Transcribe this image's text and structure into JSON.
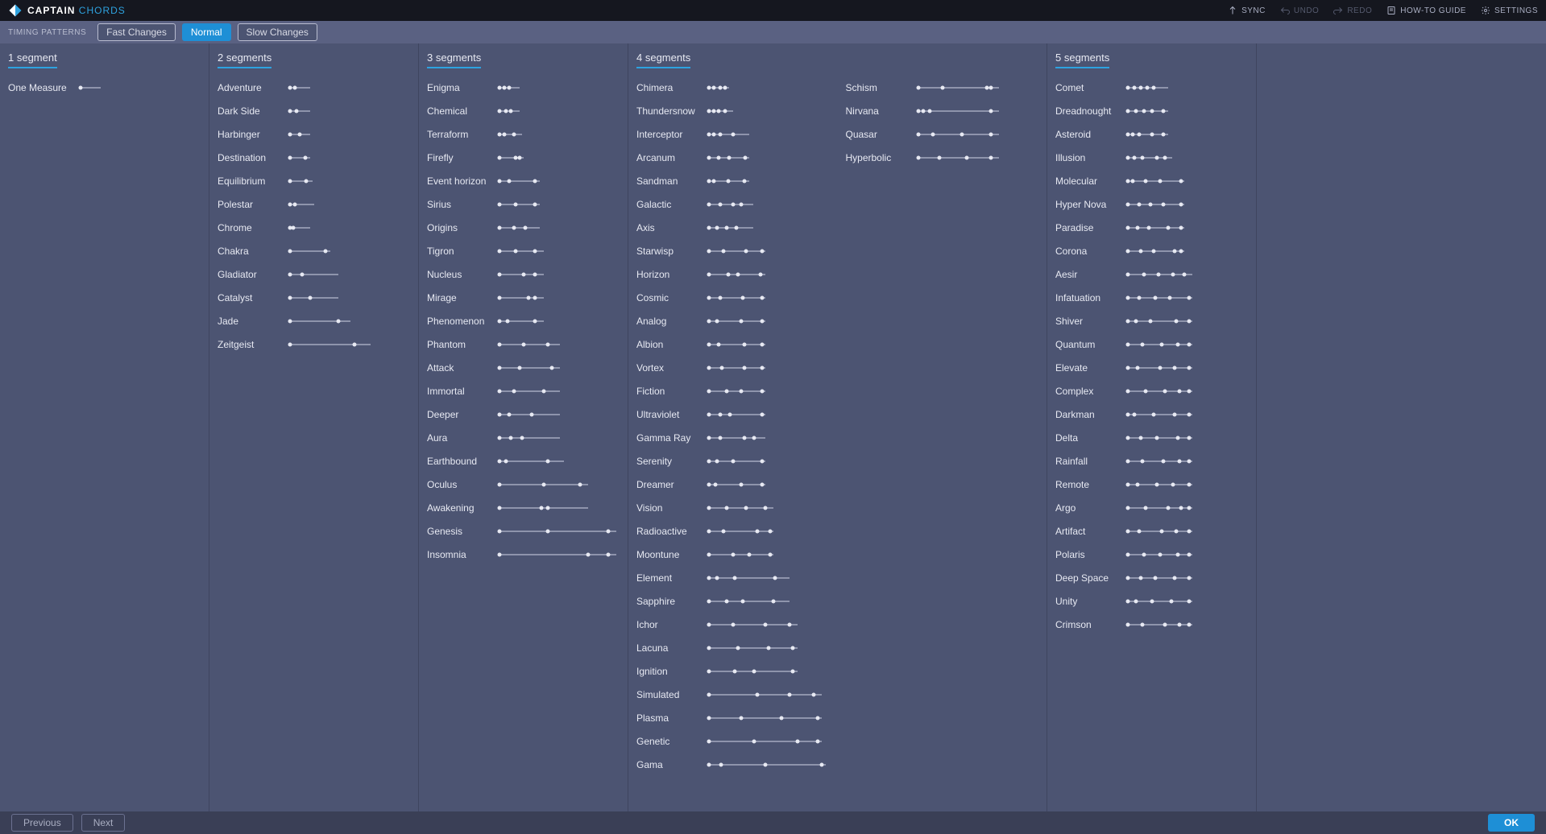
{
  "app": {
    "title_a": "CAPTAIN",
    "title_b": "CHORDS"
  },
  "topbar": {
    "sync": "SYNC",
    "undo": "UNDO",
    "redo": "REDO",
    "howto": "HOW-TO GUIDE",
    "settings": "SETTINGS"
  },
  "toolbar": {
    "label": "TIMING PATTERNS",
    "fast": "Fast Changes",
    "normal": "Normal",
    "slow": "Slow Changes"
  },
  "footer": {
    "previous": "Previous",
    "next": "Next",
    "ok": "OK"
  },
  "columns": [
    {
      "id": "seg1",
      "header": "1 segment",
      "patterns": [
        {
          "name": "One Measure",
          "dots": [
            0
          ],
          "len": 25
        }
      ]
    },
    {
      "id": "seg2",
      "header": "2 segments",
      "patterns": [
        {
          "name": "Adventure",
          "dots": [
            0,
            6
          ],
          "len": 25
        },
        {
          "name": "Dark Side",
          "dots": [
            0,
            8
          ],
          "len": 25
        },
        {
          "name": "Harbinger",
          "dots": [
            0,
            12
          ],
          "len": 25
        },
        {
          "name": "Destination",
          "dots": [
            0,
            19
          ],
          "len": 25
        },
        {
          "name": "Equilibrium",
          "dots": [
            0,
            20
          ],
          "len": 28
        },
        {
          "name": "Polestar",
          "dots": [
            0,
            6
          ],
          "len": 30
        },
        {
          "name": "Chrome",
          "dots": [
            0,
            4
          ],
          "len": 25
        },
        {
          "name": "Chakra",
          "dots": [
            0,
            44
          ],
          "len": 50
        },
        {
          "name": "Gladiator",
          "dots": [
            0,
            15
          ],
          "len": 60
        },
        {
          "name": "Catalyst",
          "dots": [
            0,
            25
          ],
          "len": 60
        },
        {
          "name": "Jade",
          "dots": [
            0,
            60
          ],
          "len": 75
        },
        {
          "name": "Zeitgeist",
          "dots": [
            0,
            80
          ],
          "len": 100
        }
      ]
    },
    {
      "id": "seg3",
      "header": "3 segments",
      "patterns": [
        {
          "name": "Enigma",
          "dots": [
            0,
            6,
            12
          ],
          "len": 25
        },
        {
          "name": "Chemical",
          "dots": [
            0,
            8,
            14
          ],
          "len": 25
        },
        {
          "name": "Terraform",
          "dots": [
            0,
            6,
            18
          ],
          "len": 28
        },
        {
          "name": "Firefly",
          "dots": [
            0,
            20,
            25
          ],
          "len": 30
        },
        {
          "name": "Event horizon",
          "dots": [
            0,
            12,
            44
          ],
          "len": 50
        },
        {
          "name": "Sirius",
          "dots": [
            0,
            20,
            44
          ],
          "len": 50
        },
        {
          "name": "Origins",
          "dots": [
            0,
            18,
            32
          ],
          "len": 50
        },
        {
          "name": "Tigron",
          "dots": [
            0,
            20,
            44
          ],
          "len": 55
        },
        {
          "name": "Nucleus",
          "dots": [
            0,
            30,
            44
          ],
          "len": 55
        },
        {
          "name": "Mirage",
          "dots": [
            0,
            36,
            44
          ],
          "len": 55
        },
        {
          "name": "Phenomenon",
          "dots": [
            0,
            10,
            44
          ],
          "len": 55
        },
        {
          "name": "Phantom",
          "dots": [
            0,
            30,
            60
          ],
          "len": 75
        },
        {
          "name": "Attack",
          "dots": [
            0,
            25,
            65
          ],
          "len": 75
        },
        {
          "name": "Immortal",
          "dots": [
            0,
            18,
            55
          ],
          "len": 75
        },
        {
          "name": "Deeper",
          "dots": [
            0,
            12,
            40
          ],
          "len": 75
        },
        {
          "name": "Aura",
          "dots": [
            0,
            14,
            28
          ],
          "len": 75
        },
        {
          "name": "Earthbound",
          "dots": [
            0,
            8,
            60
          ],
          "len": 80
        },
        {
          "name": "Oculus",
          "dots": [
            0,
            55,
            100
          ],
          "len": 110
        },
        {
          "name": "Awakening",
          "dots": [
            0,
            52,
            60
          ],
          "len": 110
        },
        {
          "name": "Genesis",
          "dots": [
            0,
            60,
            135
          ],
          "len": 145
        },
        {
          "name": "Insomnia",
          "dots": [
            0,
            110,
            135
          ],
          "len": 145
        }
      ]
    },
    {
      "id": "seg4",
      "header": "4 segments",
      "left": [
        {
          "name": "Chimera",
          "dots": [
            0,
            6,
            14,
            20
          ],
          "len": 25
        },
        {
          "name": "Thundersnow",
          "dots": [
            0,
            6,
            12,
            20
          ],
          "len": 30
        },
        {
          "name": "Interceptor",
          "dots": [
            0,
            6,
            14,
            30
          ],
          "len": 50
        },
        {
          "name": "Arcanum",
          "dots": [
            0,
            12,
            25,
            45
          ],
          "len": 50
        },
        {
          "name": "Sandman",
          "dots": [
            0,
            6,
            24,
            44
          ],
          "len": 50
        },
        {
          "name": "Galactic",
          "dots": [
            0,
            14,
            30,
            40
          ],
          "len": 55
        },
        {
          "name": "Axis",
          "dots": [
            0,
            10,
            22,
            34
          ],
          "len": 55
        },
        {
          "name": "Starwisp",
          "dots": [
            0,
            18,
            46,
            66
          ],
          "len": 70
        },
        {
          "name": "Horizon",
          "dots": [
            0,
            24,
            36,
            64
          ],
          "len": 70
        },
        {
          "name": "Cosmic",
          "dots": [
            0,
            14,
            42,
            66
          ],
          "len": 70
        },
        {
          "name": "Analog",
          "dots": [
            0,
            10,
            40,
            66
          ],
          "len": 70
        },
        {
          "name": "Albion",
          "dots": [
            0,
            12,
            44,
            66
          ],
          "len": 70
        },
        {
          "name": "Vortex",
          "dots": [
            0,
            16,
            44,
            66
          ],
          "len": 70
        },
        {
          "name": "Fiction",
          "dots": [
            0,
            22,
            40,
            66
          ],
          "len": 70
        },
        {
          "name": "Ultraviolet",
          "dots": [
            0,
            14,
            26,
            66
          ],
          "len": 70
        },
        {
          "name": "Gamma Ray",
          "dots": [
            0,
            14,
            44,
            56
          ],
          "len": 70
        },
        {
          "name": "Serenity",
          "dots": [
            0,
            10,
            30,
            66
          ],
          "len": 70
        },
        {
          "name": "Dreamer",
          "dots": [
            0,
            8,
            40,
            66
          ],
          "len": 70
        },
        {
          "name": "Vision",
          "dots": [
            0,
            22,
            46,
            70
          ],
          "len": 80
        },
        {
          "name": "Radioactive",
          "dots": [
            0,
            18,
            60,
            76
          ],
          "len": 80
        },
        {
          "name": "Moontune",
          "dots": [
            0,
            30,
            50,
            76
          ],
          "len": 80
        },
        {
          "name": "Element",
          "dots": [
            0,
            10,
            32,
            82
          ],
          "len": 100
        },
        {
          "name": "Sapphire",
          "dots": [
            0,
            22,
            42,
            80
          ],
          "len": 100
        },
        {
          "name": "Ichor",
          "dots": [
            0,
            30,
            70,
            100
          ],
          "len": 110
        },
        {
          "name": "Lacuna",
          "dots": [
            0,
            36,
            74,
            104
          ],
          "len": 110
        },
        {
          "name": "Ignition",
          "dots": [
            0,
            32,
            56,
            104
          ],
          "len": 110
        },
        {
          "name": "Simulated",
          "dots": [
            0,
            60,
            100,
            130
          ],
          "len": 140
        },
        {
          "name": "Plasma",
          "dots": [
            0,
            40,
            90,
            135
          ],
          "len": 140
        },
        {
          "name": "Genetic",
          "dots": [
            0,
            56,
            110,
            135
          ],
          "len": 140
        },
        {
          "name": "Gama",
          "dots": [
            0,
            15,
            70,
            140
          ],
          "len": 145
        }
      ],
      "right": [
        {
          "name": "Schism",
          "dots": [
            0,
            30,
            85,
            90
          ],
          "len": 100
        },
        {
          "name": "Nirvana",
          "dots": [
            0,
            6,
            14,
            90
          ],
          "len": 100
        },
        {
          "name": "Quasar",
          "dots": [
            0,
            18,
            54,
            90
          ],
          "len": 100
        },
        {
          "name": "Hyperbolic",
          "dots": [
            0,
            26,
            60,
            90
          ],
          "len": 100
        }
      ]
    },
    {
      "id": "seg5",
      "header": "5 segments",
      "patterns": [
        {
          "name": "Comet",
          "dots": [
            0,
            8,
            16,
            24,
            32
          ],
          "len": 50
        },
        {
          "name": "Dreadnought",
          "dots": [
            0,
            10,
            20,
            30,
            44
          ],
          "len": 50
        },
        {
          "name": "Asteroid",
          "dots": [
            0,
            6,
            14,
            30,
            44
          ],
          "len": 50
        },
        {
          "name": "Illusion",
          "dots": [
            0,
            8,
            18,
            36,
            46
          ],
          "len": 55
        },
        {
          "name": "Molecular",
          "dots": [
            0,
            6,
            22,
            40,
            66
          ],
          "len": 70
        },
        {
          "name": "Hyper Nova",
          "dots": [
            0,
            14,
            28,
            44,
            66
          ],
          "len": 70
        },
        {
          "name": "Paradise",
          "dots": [
            0,
            12,
            26,
            50,
            66
          ],
          "len": 70
        },
        {
          "name": "Corona",
          "dots": [
            0,
            16,
            32,
            58,
            66
          ],
          "len": 70
        },
        {
          "name": "Aesir",
          "dots": [
            0,
            20,
            38,
            56,
            70
          ],
          "len": 80
        },
        {
          "name": "Infatuation",
          "dots": [
            0,
            14,
            34,
            52,
            76
          ],
          "len": 80
        },
        {
          "name": "Shiver",
          "dots": [
            0,
            10,
            28,
            60,
            76
          ],
          "len": 80
        },
        {
          "name": "Quantum",
          "dots": [
            0,
            18,
            42,
            62,
            76
          ],
          "len": 80
        },
        {
          "name": "Elevate",
          "dots": [
            0,
            12,
            40,
            58,
            76
          ],
          "len": 80
        },
        {
          "name": "Complex",
          "dots": [
            0,
            22,
            46,
            64,
            76
          ],
          "len": 80
        },
        {
          "name": "Darkman",
          "dots": [
            0,
            8,
            32,
            58,
            76
          ],
          "len": 80
        },
        {
          "name": "Delta",
          "dots": [
            0,
            16,
            36,
            62,
            76
          ],
          "len": 80
        },
        {
          "name": "Rainfall",
          "dots": [
            0,
            18,
            44,
            64,
            76
          ],
          "len": 80
        },
        {
          "name": "Remote",
          "dots": [
            0,
            12,
            36,
            56,
            76
          ],
          "len": 80
        },
        {
          "name": "Argo",
          "dots": [
            0,
            22,
            50,
            66,
            76
          ],
          "len": 80
        },
        {
          "name": "Artifact",
          "dots": [
            0,
            14,
            42,
            60,
            76
          ],
          "len": 80
        },
        {
          "name": "Polaris",
          "dots": [
            0,
            20,
            40,
            62,
            76
          ],
          "len": 80
        },
        {
          "name": "Deep Space",
          "dots": [
            0,
            16,
            34,
            58,
            76
          ],
          "len": 80
        },
        {
          "name": "Unity",
          "dots": [
            0,
            10,
            30,
            54,
            76
          ],
          "len": 80
        },
        {
          "name": "Crimson",
          "dots": [
            0,
            18,
            46,
            64,
            76
          ],
          "len": 80
        }
      ]
    }
  ]
}
